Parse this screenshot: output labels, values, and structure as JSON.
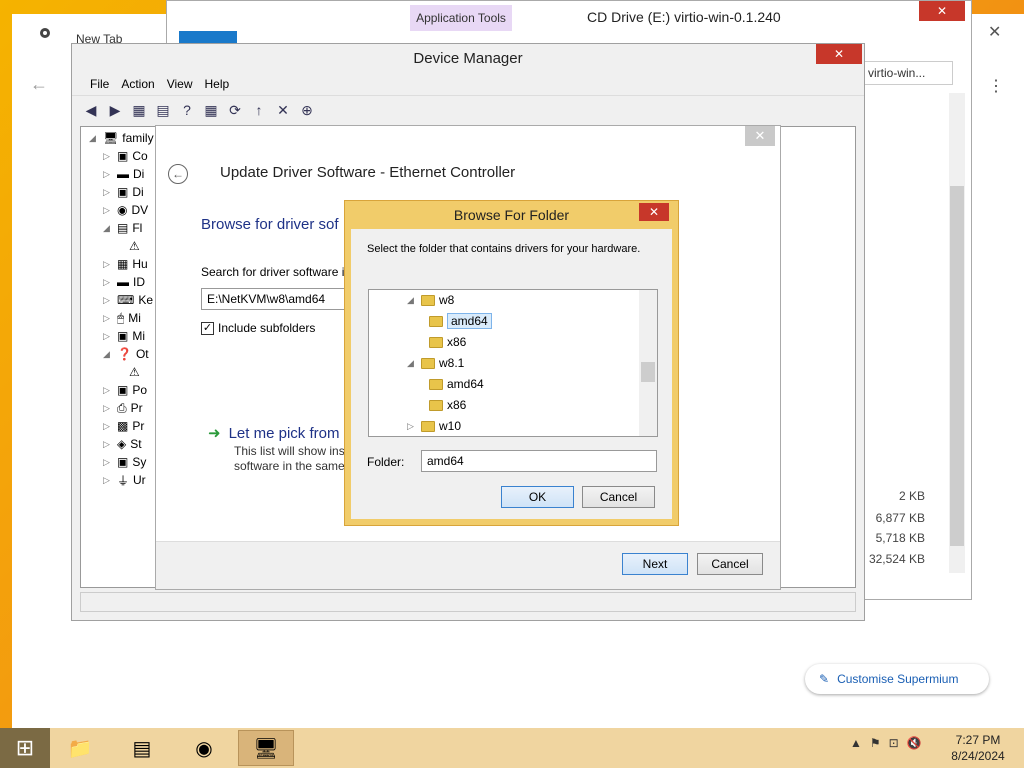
{
  "browser": {
    "tab_title": "New Tab",
    "customise_label": "Customise Supermium"
  },
  "explorer": {
    "title": "CD Drive (E:) virtio-win-0.1.240",
    "ribbon_tab": "Application Tools",
    "search_placeholder": "virtio-win...",
    "sizes": [
      "2 KB",
      "6,877 KB",
      "5,718 KB",
      "32,524 KB"
    ]
  },
  "device_manager": {
    "title": "Device Manager",
    "menus": [
      "File",
      "Action",
      "View",
      "Help"
    ],
    "tree": [
      {
        "label": "family",
        "expanded": true
      },
      {
        "label": "Co"
      },
      {
        "label": "Di"
      },
      {
        "label": "Di"
      },
      {
        "label": "DV"
      },
      {
        "label": "Fl",
        "expanded": true
      },
      {
        "label": ""
      },
      {
        "label": "Hu"
      },
      {
        "label": "ID"
      },
      {
        "label": "Ke"
      },
      {
        "label": "Mi"
      },
      {
        "label": "Mi"
      },
      {
        "label": "Ot",
        "expanded": true
      },
      {
        "label": ""
      },
      {
        "label": "Po"
      },
      {
        "label": "Pr"
      },
      {
        "label": "Pr"
      },
      {
        "label": "St"
      },
      {
        "label": "Sy"
      },
      {
        "label": "Ur"
      }
    ]
  },
  "update_driver": {
    "header": "Update Driver Software - Ethernet Controller",
    "heading": "Browse for driver sof",
    "search_label": "Search for driver software in",
    "path": "E:\\NetKVM\\w8\\amd64",
    "include_subfolders": "Include subfolders",
    "let_me_pick": "Let me pick from",
    "let_me_desc": "This list will show inst software in the same",
    "next": "Next",
    "cancel": "Cancel"
  },
  "browse_folder": {
    "title": "Browse For Folder",
    "description": "Select the folder that contains drivers for your hardware.",
    "tree": [
      {
        "label": "w8",
        "level": 0,
        "expanded": true
      },
      {
        "label": "amd64",
        "level": 1,
        "selected": true
      },
      {
        "label": "x86",
        "level": 1
      },
      {
        "label": "w8.1",
        "level": 0,
        "expanded": true
      },
      {
        "label": "amd64",
        "level": 1
      },
      {
        "label": "x86",
        "level": 1
      },
      {
        "label": "w10",
        "level": 0,
        "expanded": false
      }
    ],
    "folder_label": "Folder:",
    "folder_value": "amd64",
    "ok": "OK",
    "cancel": "Cancel"
  },
  "taskbar": {
    "time": "7:27 PM",
    "date": "8/24/2024"
  }
}
